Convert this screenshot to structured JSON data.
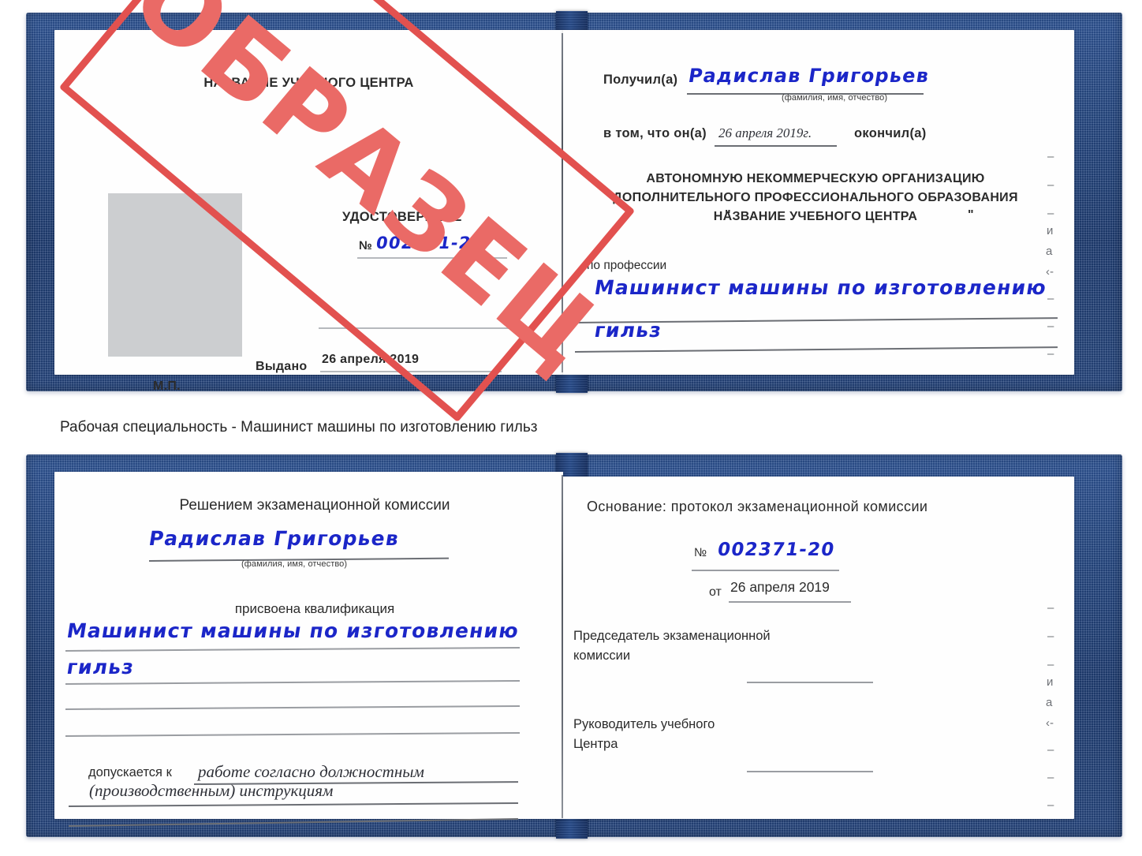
{
  "colors": {
    "cover_blue": "#27477f",
    "ink_blue": "#1b26c8",
    "stamp_red": "#e2514f",
    "photo_gray": "#ccced0",
    "rule_gray": "#9a9da2"
  },
  "watermark": {
    "text": "ОБРАЗЕЦ"
  },
  "caption": {
    "text": "Рабочая специальность - Машинист машины по изготовлению гильз"
  },
  "certificate_top": {
    "left_page": {
      "org_title": "НАЗВАНИЕ УЧЕБНОГО ЦЕНТРА",
      "doc_type": "УДОСТОВЕРЕНИЕ",
      "number_label": "№",
      "number_value": "002371-20",
      "issued_label": "Выдано",
      "issued_date": "26 апреля 2019",
      "seal_label": "М.П."
    },
    "right_page": {
      "received_label": "Получил(а)",
      "received_name": "Радислав Григорьев",
      "name_hint": "(фамилия, имя, отчество)",
      "that_he_label": "в том, что он(а)",
      "completion_date": "26 апреля 2019г.",
      "finished_label": "окончил(а)",
      "org_line1": "АВТОНОМНУЮ НЕКОММЕРЧЕСКУЮ ОРГАНИЗАЦИЮ",
      "org_line2": "ДОПОЛНИТЕЛЬНОГО ПРОФЕССИОНАЛЬНОГО ОБРАЗОВАНИЯ",
      "org_quote_open": "\"",
      "org_line3": "НАЗВАНИЕ УЧЕБНОГО ЦЕНТРА",
      "org_quote_close": "\"",
      "profession_label": "по профессии",
      "profession_value_line1": "Машинист машины по изготовлению",
      "profession_value_line2": "гильз",
      "edge_fragments": [
        "–",
        "–",
        "–",
        "и",
        "а",
        "‹-",
        "–",
        "–",
        "–"
      ]
    }
  },
  "certificate_bottom": {
    "left_page": {
      "decision_title": "Решением экзаменационной комиссии",
      "name_value": "Радислав Григорьев",
      "name_hint": "(фамилия, имя, отчество)",
      "qualification_label": "присвоена квалификация",
      "qualification_line1": "Машинист машины по изготовлению",
      "qualification_line2": "гильз",
      "admitted_label": "допускается к",
      "admitted_value_line1": "работе согласно должностным",
      "admitted_value_line2": "(производственным) инструкциям"
    },
    "right_page": {
      "basis_label": "Основание: протокол экзаменационной комиссии",
      "number_label": "№",
      "number_value": "002371-20",
      "date_label": "от",
      "date_value": "26 апреля 2019",
      "chairman_line1": "Председатель экзаменационной",
      "chairman_line2": "комиссии",
      "head_line1": "Руководитель учебного",
      "head_line2": "Центра",
      "edge_fragments": [
        "–",
        "–",
        "–",
        "и",
        "а",
        "‹-",
        "–",
        "–",
        "–"
      ]
    }
  }
}
